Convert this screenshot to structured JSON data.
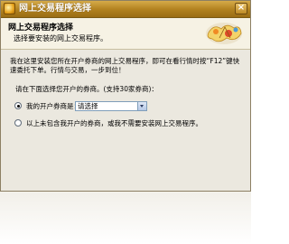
{
  "window": {
    "title": "网上交易程序选择",
    "close_glyph": "×"
  },
  "header": {
    "title": "网上交易程序选择",
    "subtitle": "选择要安装的网上交易程序。"
  },
  "content": {
    "intro": "我在这里安装您所在开户券商的网上交易程序，即可在看行情时按“F12”键快速委托下单。行情与交易，一步到位！",
    "prompt": "请在下面选择您开户的券商。(支持30家券商)：",
    "option_broker_label": "我的开户券商是：",
    "broker_select": {
      "selected": "请选择"
    },
    "option_skip_label": "以上未包含我开户的券商，或我不需要安装网上交易程序。",
    "selected_option": "broker"
  },
  "colors": {
    "title_bar": "#b0801e",
    "window_bg": "#ece7d4",
    "content_bg": "#ebe8df",
    "header_bg": "#f6f2e4"
  },
  "icons": {
    "app": "app-icon",
    "close": "close-icon",
    "logo": "logo-icon",
    "dropdown": "chevron-down-icon"
  }
}
